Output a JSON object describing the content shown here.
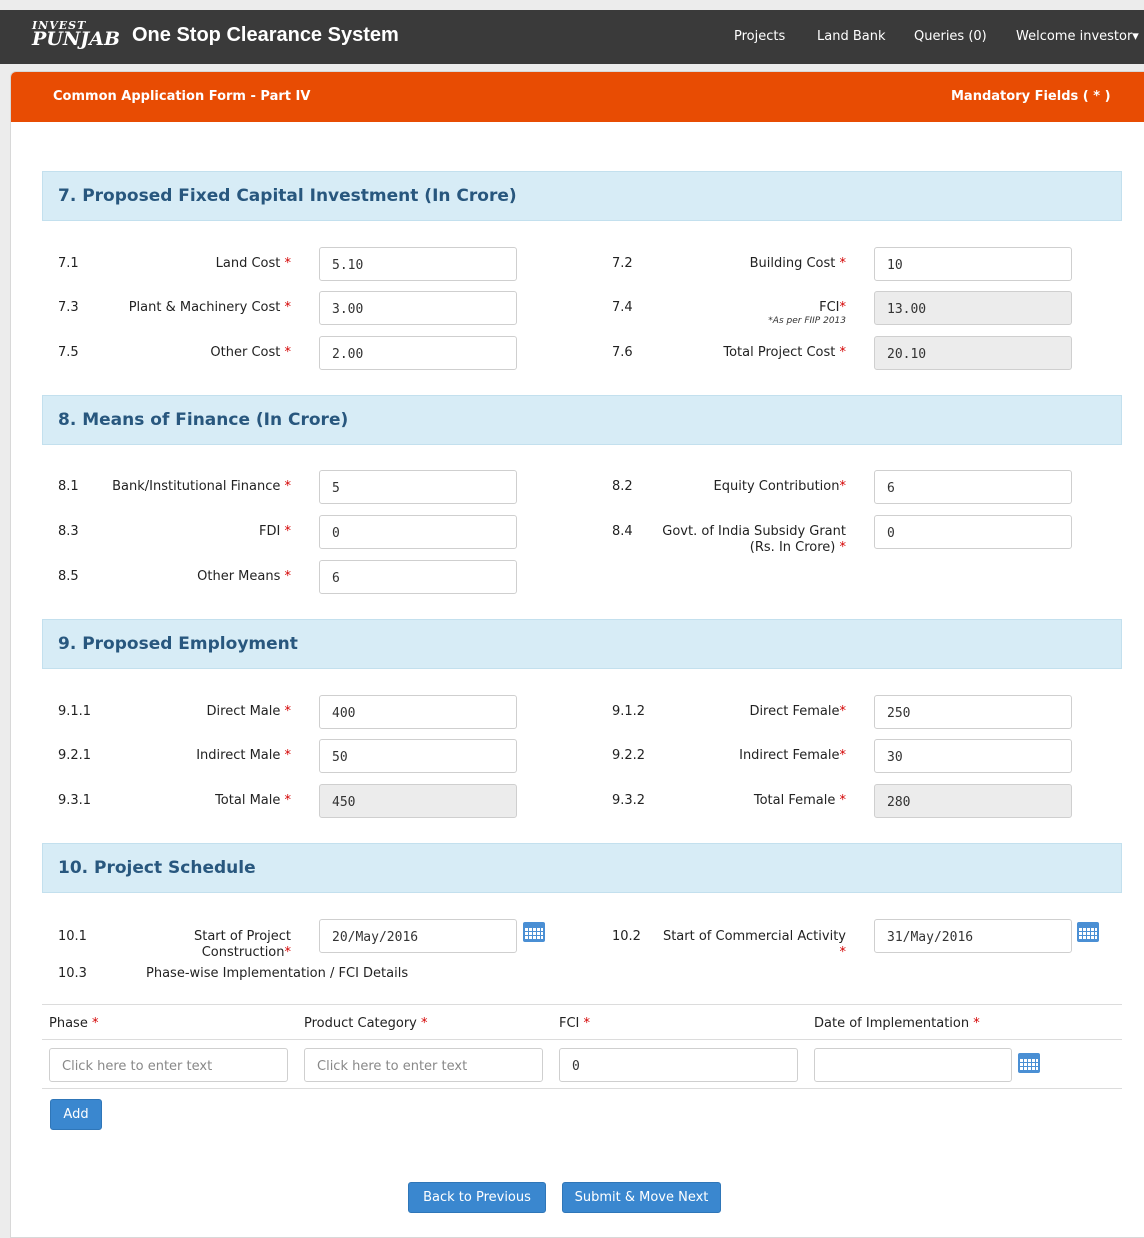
{
  "topbar": {
    "logo_line1": "INVEST",
    "logo_line2": "PUNJAB",
    "title": "One Stop Clearance System",
    "nav": [
      "Projects",
      "Land Bank",
      "Queries (0)",
      "Welcome investor▾"
    ]
  },
  "form": {
    "title": "Common Application Form - Part IV",
    "mandatory": "Mandatory Fields ( * )"
  },
  "sections": {
    "s7": "7. Proposed Fixed Capital Investment (In Crore)",
    "s8": "8. Means of Finance (In Crore)",
    "s9": "9. Proposed Employment",
    "s10": "10. Project Schedule"
  },
  "fields": {
    "f71": {
      "num": "7.1",
      "label": "Land Cost ",
      "value": "5.10"
    },
    "f72": {
      "num": "7.2",
      "label": "Building Cost ",
      "value": "10"
    },
    "f73": {
      "num": "7.3",
      "label": "Plant & Machinery Cost ",
      "value": "3.00"
    },
    "f74": {
      "num": "7.4",
      "label": "FCI",
      "note": "*As per FIIP 2013",
      "value": "13.00"
    },
    "f75": {
      "num": "7.5",
      "label": "Other Cost ",
      "value": "2.00"
    },
    "f76": {
      "num": "7.6",
      "label": "Total Project Cost ",
      "value": "20.10"
    },
    "f81": {
      "num": "8.1",
      "label": "Bank/Institutional Finance ",
      "value": "5"
    },
    "f82": {
      "num": "8.2",
      "label": "Equity Contribution",
      "value": "6"
    },
    "f83": {
      "num": "8.3",
      "label": "FDI ",
      "value": "0"
    },
    "f84": {
      "num": "8.4",
      "label_l1": "Govt. of India Subsidy Grant",
      "label_l2": "(Rs. In Crore) ",
      "value": "0"
    },
    "f85": {
      "num": "8.5",
      "label": "Other Means ",
      "value": "6"
    },
    "f911": {
      "num": "9.1.1",
      "label": "Direct Male ",
      "value": "400"
    },
    "f912": {
      "num": "9.1.2",
      "label": "Direct Female",
      "value": "250"
    },
    "f921": {
      "num": "9.2.1",
      "label": "Indirect Male ",
      "value": "50"
    },
    "f922": {
      "num": "9.2.2",
      "label": "Indirect Female",
      "value": "30"
    },
    "f931": {
      "num": "9.3.1",
      "label": "Total Male ",
      "value": "450"
    },
    "f932": {
      "num": "9.3.2",
      "label": "Total Female ",
      "value": "280"
    },
    "f101": {
      "num": "10.1",
      "label_l1": "Start of Project",
      "label_l2": "Construction",
      "value": "20/May/2016"
    },
    "f102": {
      "num": "10.2",
      "label": "Start of Commercial Activity",
      "value": "31/May/2016"
    },
    "f103": {
      "num": "10.3",
      "label": "Phase-wise Implementation / FCI Details"
    }
  },
  "required_mark": "*",
  "phase_table": {
    "headers": [
      "Phase ",
      "Product Category ",
      "FCI ",
      "Date of Implementation "
    ],
    "placeholder": "Click here to enter text",
    "fci_value": "0",
    "date_value": ""
  },
  "buttons": {
    "add": "Add",
    "back": "Back to Previous",
    "submit": "Submit & Move Next"
  },
  "colors": {
    "header_orange": "#e84c03",
    "section_bg": "#d7ecf6",
    "section_text": "#28577e",
    "button_blue": "#3a87cf",
    "required_red": "#d40000"
  }
}
